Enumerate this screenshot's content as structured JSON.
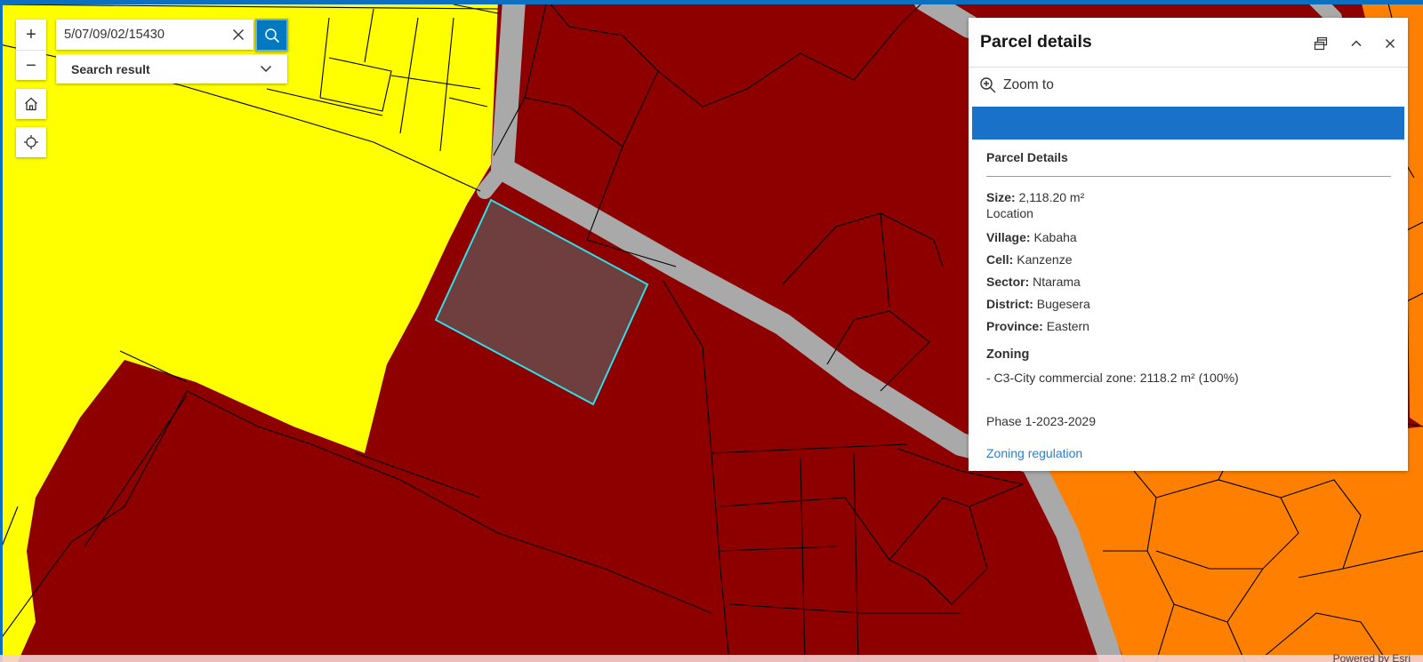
{
  "map": {
    "colors": {
      "commercial": "#8e0000",
      "residential": "#ffff00",
      "other_zone": "#ff8000",
      "road": "#a9a9a9",
      "selected_fill": "#6f3f3f",
      "selected_outline": "#2de0e8"
    },
    "attribution": "Powered by Esri"
  },
  "controls": {
    "zoom_in": "+",
    "zoom_out": "−"
  },
  "search": {
    "value": "5/07/09/02/15430",
    "result_label": "Search result"
  },
  "panel": {
    "title": "Parcel details",
    "zoom_to": "Zoom to",
    "section_title": "Parcel Details",
    "size_label": "Size:",
    "size_value": "2,118.20 m²",
    "location_label": "Location",
    "village_label": "Village:",
    "village_value": "Kabaha",
    "cell_label": "Cell:",
    "cell_value": "Kanzenze",
    "sector_label": "Sector:",
    "sector_value": "Ntarama",
    "district_label": "District:",
    "district_value": "Bugesera",
    "province_label": "Province:",
    "province_value": "Eastern",
    "zoning_title": "Zoning",
    "zoning_line": "- C3-City commercial zone: 2118.2 m² (100%)",
    "phase": "Phase 1-2023-2029",
    "regulation_link": "Zoning regulation"
  }
}
